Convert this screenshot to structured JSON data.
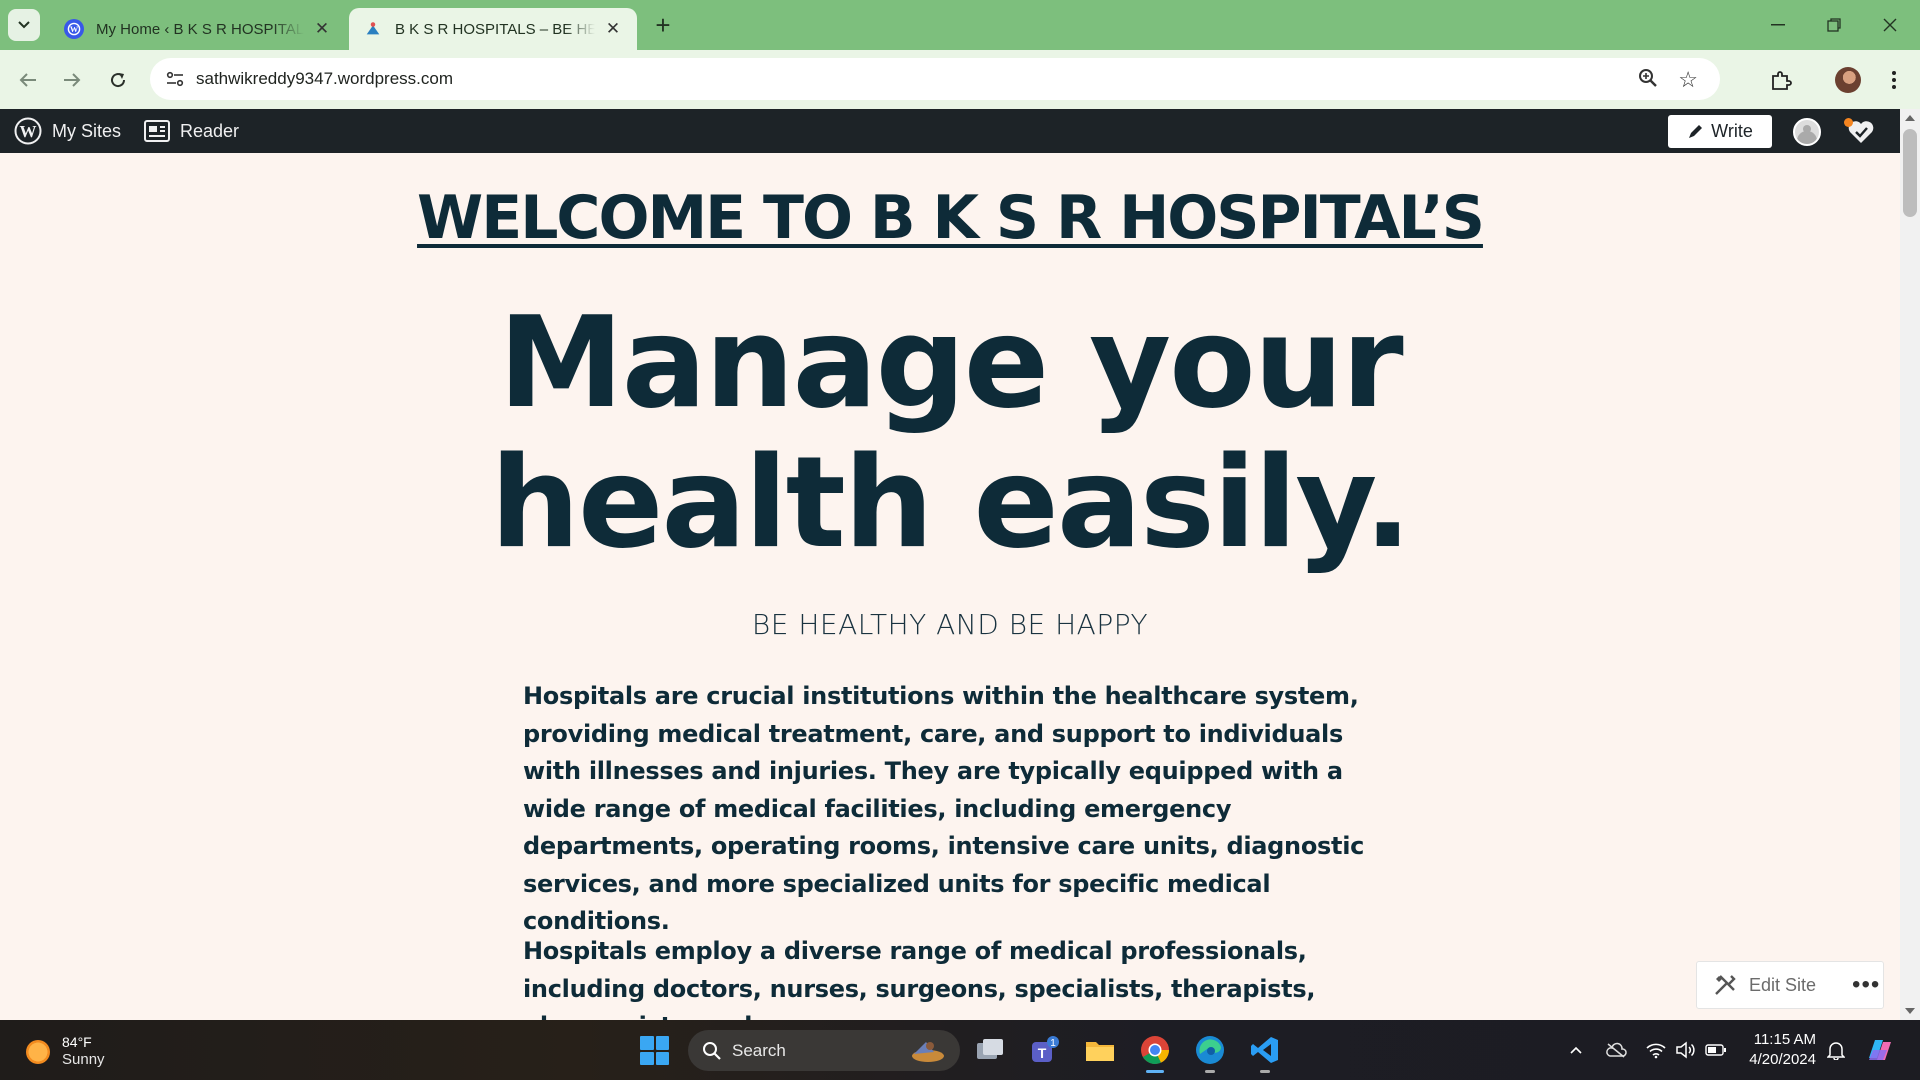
{
  "browser": {
    "tabs": [
      {
        "title": "My Home ‹ B K S R HOSPITALS — WordPress.com",
        "active": false
      },
      {
        "title": "B K S R HOSPITALS – BE HEALTHY AND BE HAPPY",
        "active": true
      }
    ],
    "url": "sathwikreddy9347.wordpress.com"
  },
  "wp_admin_bar": {
    "my_sites": "My Sites",
    "reader": "Reader",
    "write": "Write"
  },
  "page": {
    "welcome_heading": "WELCOME TO B K S R HOSPITAL’S",
    "hero_line1": "Manage your",
    "hero_line2": "health easily.",
    "tagline": "BE HEALTHY AND BE HAPPY",
    "paragraph1": "Hospitals are crucial institutions within the healthcare system, providing medical treatment, care, and support to individuals with illnesses and injuries. They are typically equipped with a wide range of medical facilities, including emergency departments, operating rooms, intensive care units, diagnostic services, and more specialized units for specific medical conditions.",
    "paragraph2": "Hospitals employ a diverse range of medical professionals, including doctors, nurses, surgeons, specialists, therapists, pharmacists, and",
    "edit_site": "Edit Site"
  },
  "taskbar": {
    "weather_temp": "84°F",
    "weather_desc": "Sunny",
    "search_label": "Search",
    "teams_badge": "1",
    "time": "11:15 AM",
    "date": "4/20/2024"
  },
  "colors": {
    "tabbar": "#7dbf7d",
    "toolbar": "#eaf5e6",
    "wp_bar": "#1d2327",
    "page_bg": "#fdf4ef",
    "heading_text": "#0e2b38"
  }
}
